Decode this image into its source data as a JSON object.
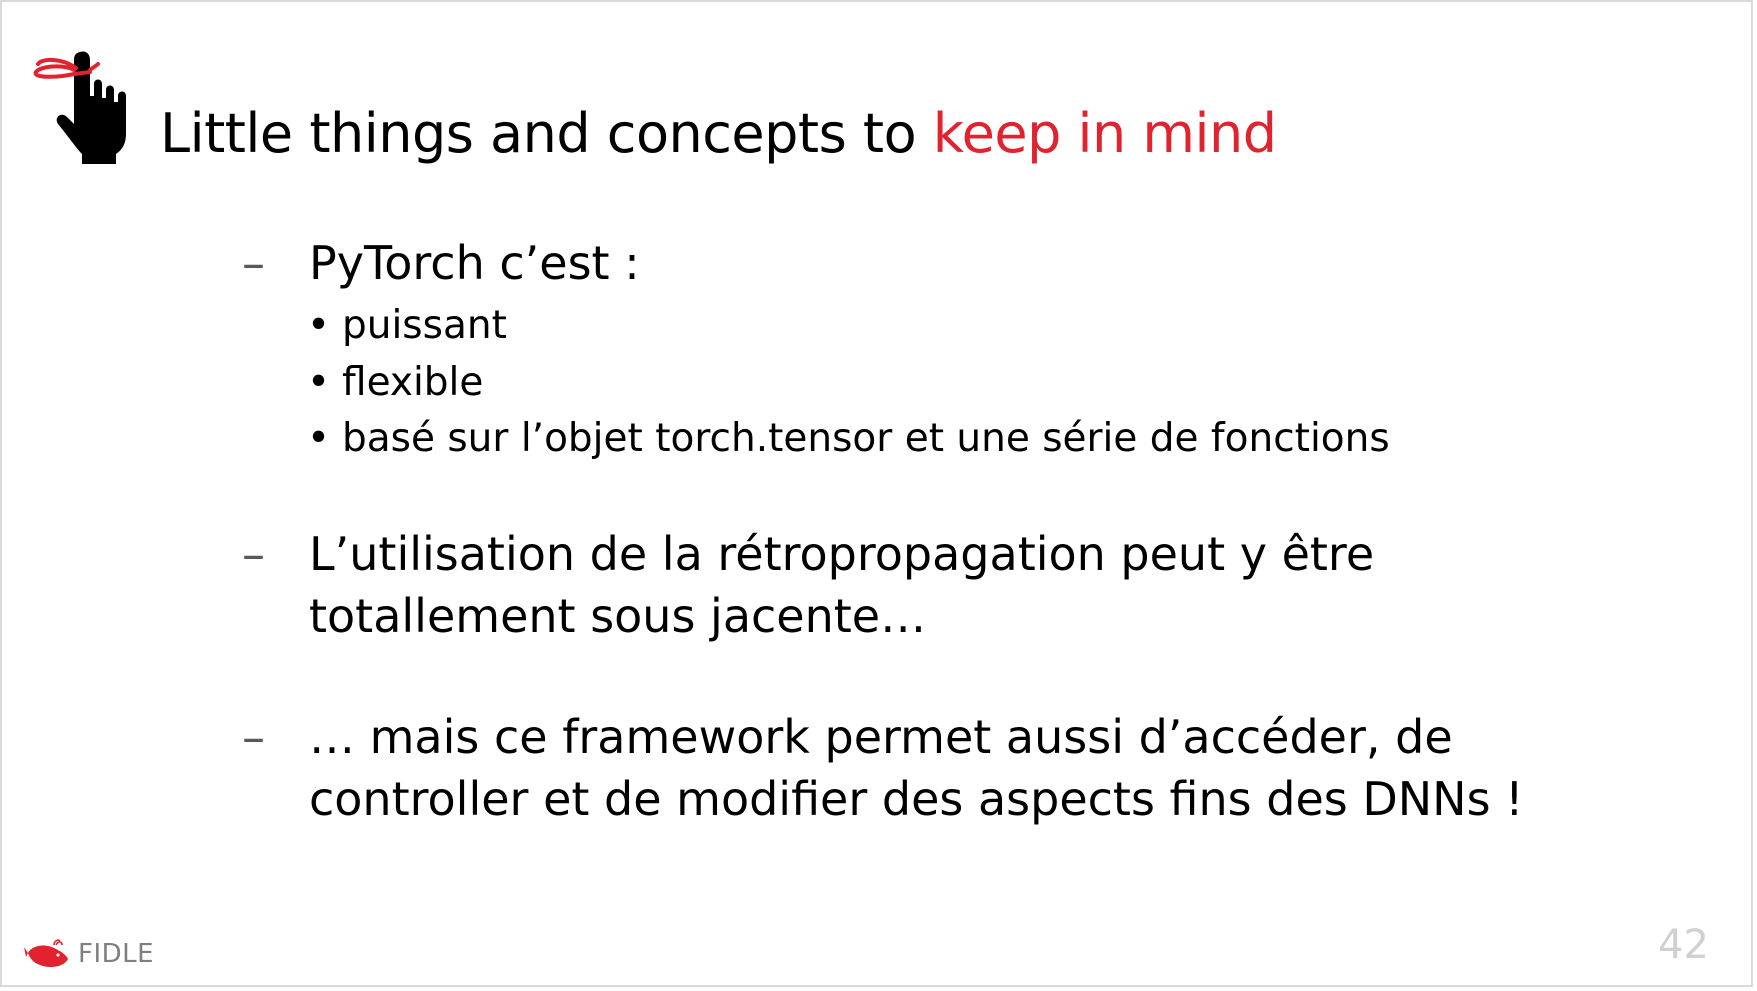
{
  "title": {
    "main": "Little things and concepts to ",
    "accent": "keep in mind"
  },
  "items": [
    {
      "dash": "–",
      "text": "PyTorch c’est :",
      "subitems": [
        {
          "bullet": "•",
          "text": "puissant"
        },
        {
          "bullet": "•",
          "text": "flexible"
        },
        {
          "bullet": "•",
          "text": "basé sur l’objet torch.tensor et une série de fonctions"
        }
      ]
    },
    {
      "dash": "–",
      "lines": [
        "L’utilisation de la rétropropagation peut y être",
        "totallement sous jacente…"
      ]
    },
    {
      "dash": "–",
      "lines": [
        "… mais ce framework permet aussi d’accéder, de",
        "controller et de modifier des aspects fins des DNNs !"
      ]
    }
  ],
  "footer": {
    "brand": "FIDLE",
    "page_number": "42"
  },
  "colors": {
    "accent": "#e0232e",
    "dash": "#595959",
    "footer_text": "#7f7f7f",
    "page_number": "#d0d0d0"
  },
  "icons": [
    "hand-with-string-icon",
    "whale-logo-icon"
  ]
}
